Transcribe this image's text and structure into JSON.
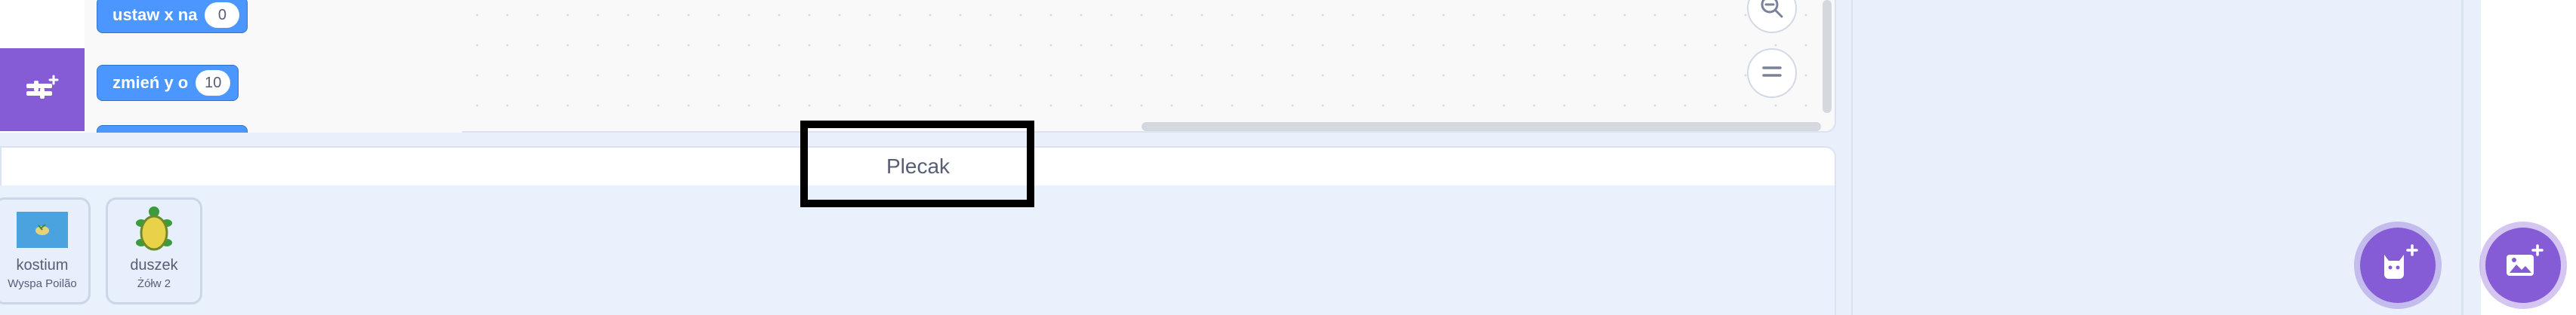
{
  "blocks": {
    "set_x": {
      "label": "ustaw x na",
      "value": "0"
    },
    "change_y": {
      "label": "zmień y o",
      "value": "10"
    }
  },
  "backpack": {
    "title": "Plecak",
    "items": [
      {
        "name": "kostium",
        "sub": "Wyspa Poilão",
        "icon": "island-costume-thumbnail"
      },
      {
        "name": "duszek",
        "sub": "Żółw 2",
        "icon": "turtle-sprite-thumbnail"
      }
    ]
  },
  "icons": {
    "extensions": "add-extension-icon",
    "zoom_out": "zoom-out-icon",
    "zoom_reset": "zoom-reset-icon",
    "sprite": "choose-sprite-icon",
    "backdrop": "choose-backdrop-icon"
  },
  "colors": {
    "motion": "#4c97ff",
    "accent": "#855cd6",
    "text": "#575e75",
    "highlight": "#000000"
  }
}
